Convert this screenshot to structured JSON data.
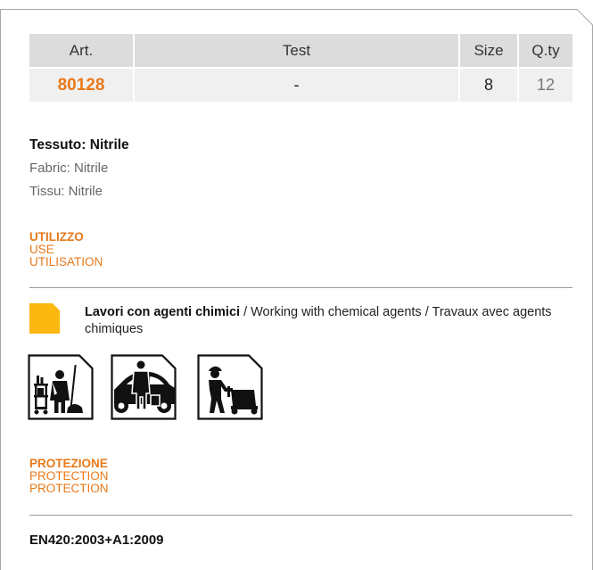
{
  "table": {
    "headers": {
      "art": "Art.",
      "test": "Test",
      "size": "Size",
      "qty": "Q.ty"
    },
    "row": {
      "art": "80128",
      "test": "-",
      "size": "8",
      "qty": "12"
    }
  },
  "fabric": {
    "it": "Tessuto: Nitrile",
    "en": "Fabric: Nitrile",
    "fr": "Tissu: Nitrile"
  },
  "use_section": {
    "it": "UTILIZZO",
    "en": "USE",
    "fr": "UTILISATION"
  },
  "use_item": {
    "bold": "Lavori con agenti chimici",
    "rest": " / Working with chemical agents / Travaux avec agents chimiques"
  },
  "use_icons": [
    "cleaning-worker-icon",
    "car-wash-icon",
    "floor-scrubber-icon"
  ],
  "protection_section": {
    "it": "PROTEZIONE",
    "en": "PROTECTION",
    "fr": "PROTECTION"
  },
  "standard": "EN420:2003+A1:2009",
  "colors": {
    "accent": "#e8791a",
    "use_marker": "#fbb80f",
    "header_bg": "#dcdcdc",
    "row_bg": "#f0f0f0"
  }
}
